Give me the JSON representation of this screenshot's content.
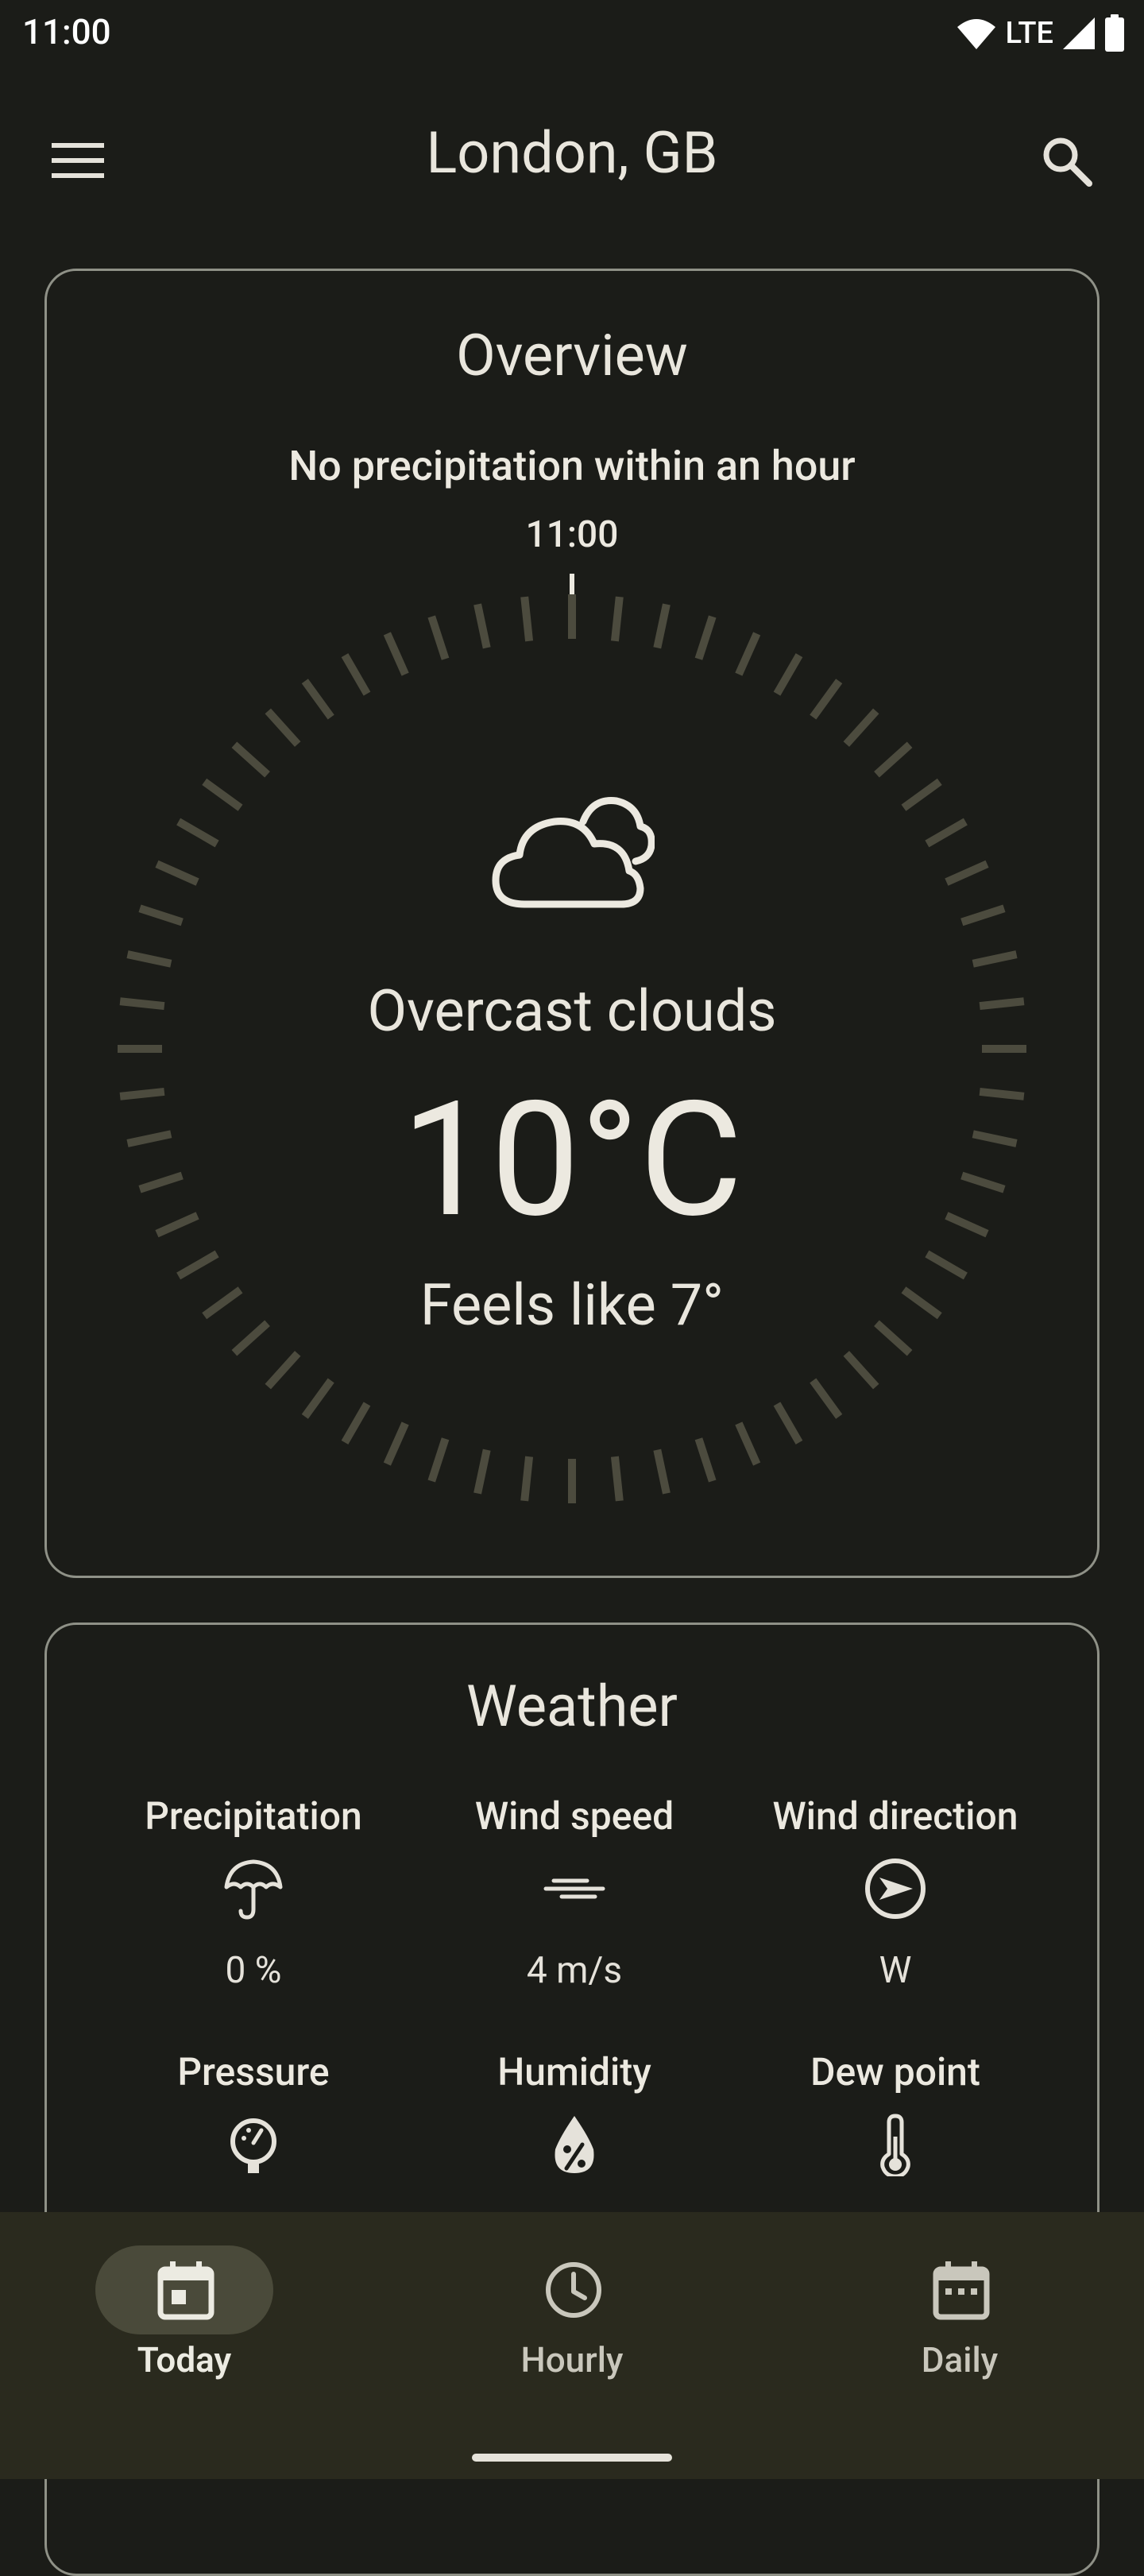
{
  "status_bar": {
    "time": "11:00",
    "network": "LTE",
    "icons": [
      "wifi-icon",
      "signal-icon",
      "battery-icon"
    ]
  },
  "app_bar": {
    "title": "London, GB",
    "menu_icon": "menu-icon",
    "search_icon": "search-icon"
  },
  "overview": {
    "title": "Overview",
    "precipitation_note": "No precipitation within an hour",
    "dial_time": "11:00",
    "condition_icon": "cloud-icon",
    "condition": "Overcast clouds",
    "temperature": "10°C",
    "feels_like": "Feels like 7°"
  },
  "weather": {
    "title": "Weather",
    "stats": [
      {
        "label": "Precipitation",
        "icon": "umbrella-icon",
        "value": "0 %"
      },
      {
        "label": "Wind speed",
        "icon": "wind-icon",
        "value": "4 m/s"
      },
      {
        "label": "Wind direction",
        "icon": "compass-arrow-icon",
        "value": "W"
      },
      {
        "label": "Pressure",
        "icon": "gauge-icon"
      },
      {
        "label": "Humidity",
        "icon": "humidity-drop-icon"
      },
      {
        "label": "Dew point",
        "icon": "thermometer-icon"
      }
    ]
  },
  "bottom_nav": {
    "items": [
      {
        "label": "Today",
        "icon": "calendar-today-icon",
        "active": true
      },
      {
        "label": "Hourly",
        "icon": "clock-icon",
        "active": false
      },
      {
        "label": "Daily",
        "icon": "calendar-icon",
        "active": false
      }
    ]
  },
  "colors": {
    "background": "#1b1c18",
    "card_border": "#8f9187",
    "dial_tick": "#4c4b3e",
    "nav_background": "#2a2a1e",
    "nav_pill": "#4a4a3a",
    "text": "#e9e6dd"
  }
}
